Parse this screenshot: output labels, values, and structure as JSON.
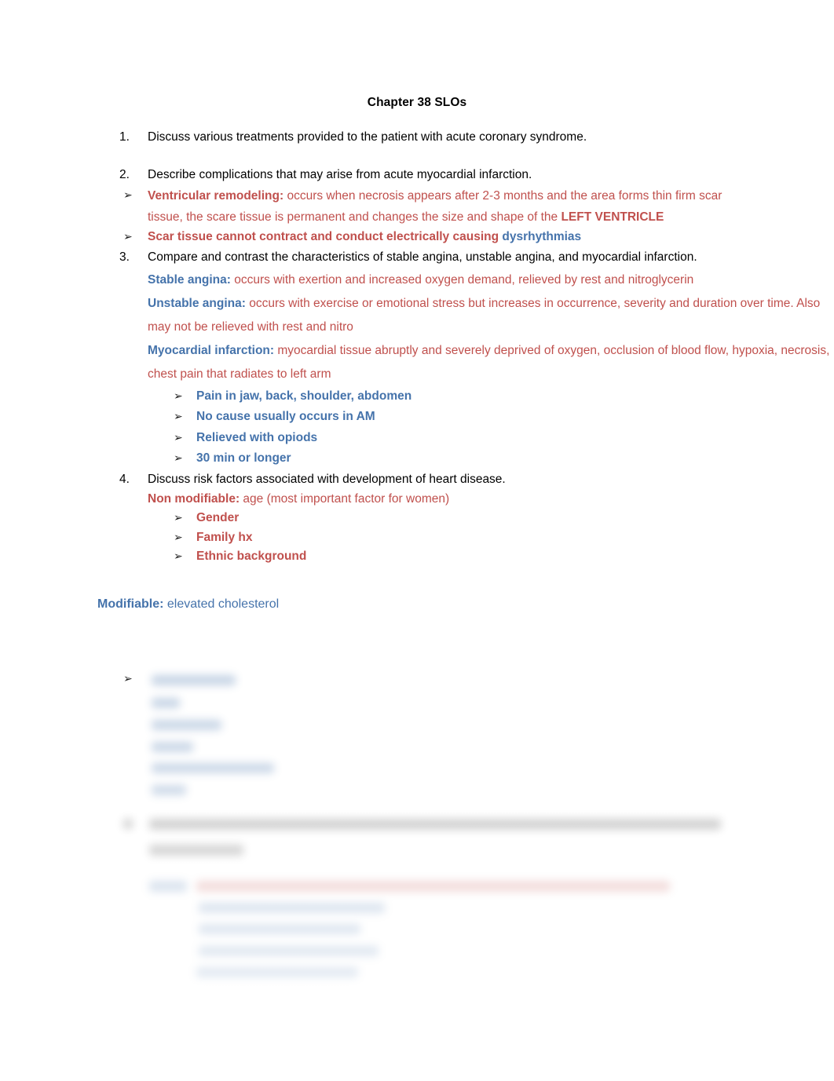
{
  "document": {
    "title": "Chapter 38 SLOs",
    "bullet_glyph": "➢",
    "colors": {
      "red": "#c0504d",
      "blue": "#4573ab",
      "black": "#000000",
      "page_background": "#ffffff"
    }
  },
  "items": {
    "item1": {
      "number": "1.",
      "text": "Discuss various treatments provided to the patient with acute coronary syndrome."
    },
    "item2": {
      "number": "2.",
      "text": "Describe complications that may arise from acute myocardial infarction.",
      "bullets": [
        {
          "label": "Ventricular remodeling:",
          "body": " occurs when necrosis appears after 2-3 months and the area forms thin firm scar tissue, the scare tissue is permanent and changes the size and shape of the ",
          "emphasis": "LEFT VENTRICLE"
        },
        {
          "label": "Scar tissue cannot contract and conduct electrically causing",
          "trailing": "dysrhythmias"
        }
      ]
    },
    "item3": {
      "number": "3.",
      "text": "Compare and contrast the characteristics of stable angina, unstable angina, and myocardial infarction.",
      "definitions": [
        {
          "label": "Stable angina:",
          "body": " occurs with exertion and increased oxygen demand, relieved by rest and nitroglycerin"
        },
        {
          "label": "Unstable angina:",
          "body": " occurs with exercise or emotional stress but increases in occurrence, severity and duration over time. Also may not be relieved with rest and nitro"
        },
        {
          "label": "Myocardial infarction:",
          "body": " myocardial tissue abruptly and severely deprived of oxygen, occlusion of blood flow, hypoxia, necrosis, chest pain that radiates to left arm"
        }
      ],
      "sub_bullets": [
        "Pain in jaw, back, shoulder, abdomen",
        "No cause usually occurs in AM",
        "Relieved with opiods",
        "30 min or longer"
      ]
    },
    "item4": {
      "number": "4.",
      "text": "Discuss risk factors associated with development of heart disease.",
      "non_modifiable": {
        "label": "Non modifiable:",
        "body": " age (most important factor for women)",
        "sub_bullets": [
          "Gender",
          "Family hx",
          "Ethnic background"
        ]
      },
      "modifiable": {
        "label": "Modifiable:",
        "body": " elevated cholesterol"
      }
    }
  },
  "obscured_preview": {
    "note": "Remaining page content is blurred out and not legible."
  }
}
